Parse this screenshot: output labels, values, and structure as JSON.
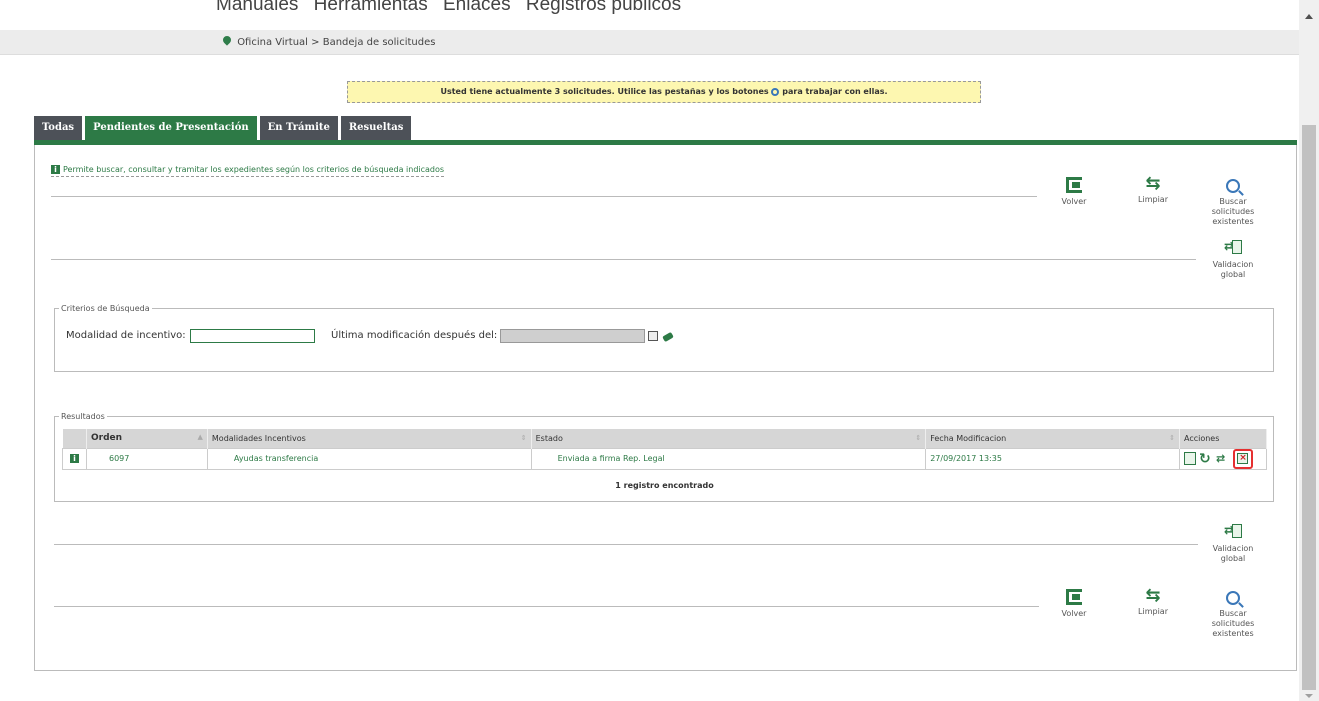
{
  "topnav": {
    "items": [
      "Manuales",
      "Herramientas",
      "Enlaces",
      "Registros públicos"
    ]
  },
  "breadcrumb": {
    "home": "Oficina Virtual",
    "separator": ">",
    "current": "Bandeja de solicitudes"
  },
  "notice": {
    "text_before": "Usted tiene actualmente 3 solicitudes. Utilice las pestañas y los botones",
    "text_after": "para trabajar con ellas."
  },
  "tabs": [
    "Todas",
    "Pendientes de Presentación",
    "En Trámite",
    "Resueltas"
  ],
  "info_text": "Permite buscar, consultar y tramitar los expedientes según los criterios de búsqueda indicados",
  "actions": {
    "volver": "Volver",
    "limpiar": "Limpiar",
    "buscar": "Buscar solicitudes existentes",
    "validacion": "Validacion global"
  },
  "criteria": {
    "legend": "Criterios de Búsqueda",
    "modalidad_label": "Modalidad de incentivo:",
    "modalidad_value": "",
    "fecha_label": "Última modificación después del:",
    "fecha_value": ""
  },
  "results": {
    "legend": "Resultados",
    "columns": [
      "Orden",
      "Modalidades Incentivos",
      "Estado",
      "Fecha Modificacion",
      "Acciones"
    ],
    "rows": [
      {
        "orden": "6097",
        "modalidad": "Ayudas transferencia",
        "estado": "Enviada a firma Rep. Legal",
        "fecha": "27/09/2017 13:35"
      }
    ],
    "count_text": "1 registro encontrado"
  },
  "colors": {
    "accent": "#2d7a46",
    "tab_inactive": "#4d5158",
    "notice_bg": "#fdf7b0",
    "highlight": "#e53030"
  }
}
